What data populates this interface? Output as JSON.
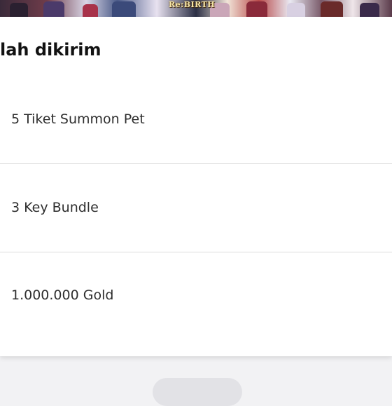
{
  "banner": {
    "logo_text": "Re:BIRTH"
  },
  "card": {
    "title": "lah dikirim",
    "items": [
      {
        "label": "5 Tiket Summon Pet"
      },
      {
        "label": "3 Key Bundle"
      },
      {
        "label": "1.000.000 Gold"
      }
    ]
  }
}
